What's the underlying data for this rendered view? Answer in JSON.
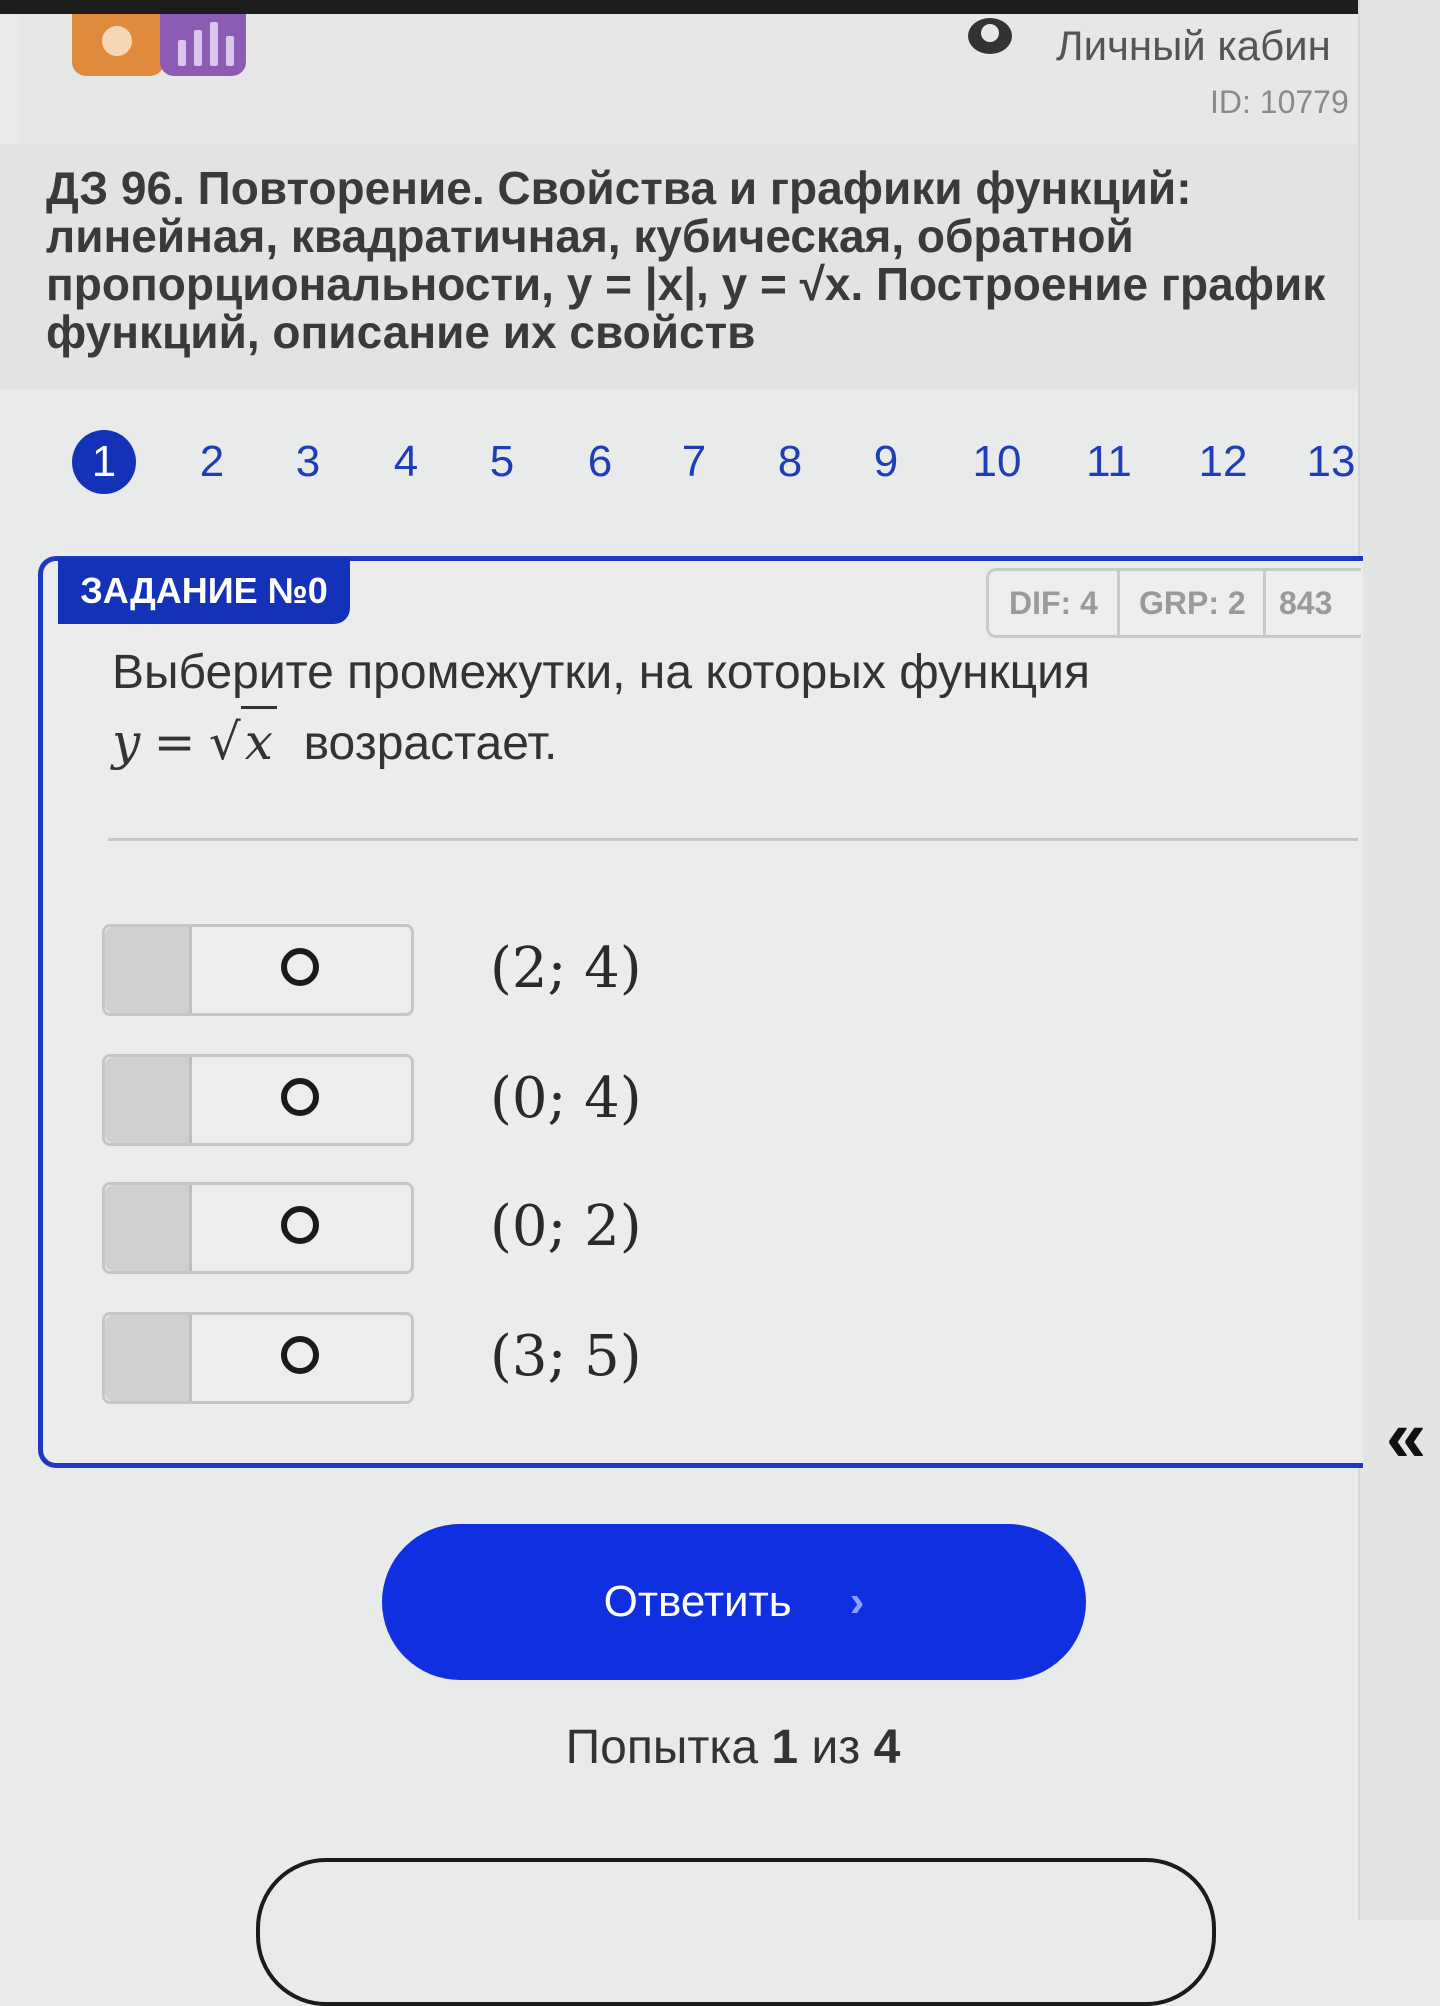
{
  "header": {
    "cabinet_label": "Личный кабин",
    "user_id": "ID: 10779"
  },
  "assignment": {
    "title": "ДЗ 96. Повторение. Свойства и графики функций: линейная, квадратичная, кубическая, обратной пропорциональности, y = |x|, y = √x. Построение график функций, описание их свойств"
  },
  "nav": {
    "items": [
      "1",
      "2",
      "3",
      "4",
      "5",
      "6",
      "7",
      "8",
      "9",
      "10",
      "11",
      "12",
      "13"
    ],
    "active": "1"
  },
  "task": {
    "tag": "ЗАДАНИЕ №0",
    "meta": {
      "dif": "DIF: 4",
      "grp": "GRP: 2",
      "id": "843"
    },
    "question_text": "Выберите промежутки, на которых функция",
    "formula_lhs": "y",
    "formula_eq": "=",
    "formula_sqrt": "√",
    "formula_arg": "x",
    "question_end": "возрастает.",
    "options": [
      {
        "label": "(2; 4)"
      },
      {
        "label": "(0; 4)"
      },
      {
        "label": "(0; 2)"
      },
      {
        "label": "(3; 5)"
      }
    ]
  },
  "submit_label": "Ответить",
  "submit_chevron": "›",
  "collapse_glyph": "«",
  "attempt": {
    "prefix": "Попытка",
    "current": "1",
    "sep": "из",
    "total": "4"
  }
}
